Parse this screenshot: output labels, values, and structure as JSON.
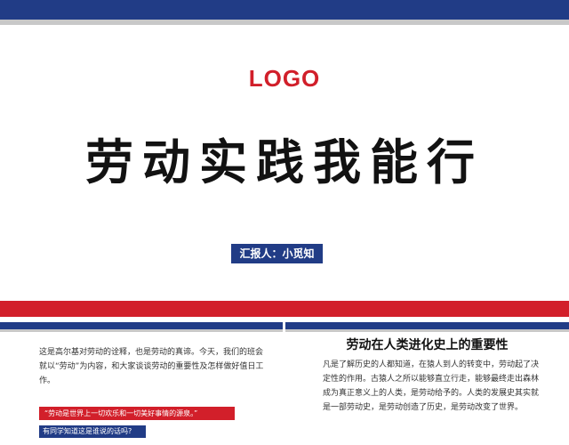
{
  "colors": {
    "accent_blue": "#213c86",
    "accent_red": "#d21f2a",
    "title_black": "#121212",
    "gray_band": "#c8c8c8"
  },
  "slide1": {
    "logo": "LOGO",
    "title": "劳动实践我能行",
    "presenter": "汇报人：小觅知"
  },
  "slide2": {
    "paragraph": "这是高尔基对劳动的诠释，也是劳动的真谛。今天，我们的班会就以“劳动”为内容，和大家谈谈劳动的重要性及怎样做好值日工作。",
    "quote": "“劳动是世界上一切欢乐和一切美好事情的源泉。”",
    "question": "有同学知道这是谁说的话吗?"
  },
  "slide3": {
    "heading": "劳动在人类进化史上的重要性",
    "paragraph": "凡是了解历史的人都知道，在猿人到人的转变中，劳动起了决定性的作用。古猿人之所以能够直立行走，能够最终走出森林成为真正意义上的人类，是劳动给予的。人类的发展史其实就是一部劳动史，是劳动创造了历史，是劳动改变了世界。"
  }
}
